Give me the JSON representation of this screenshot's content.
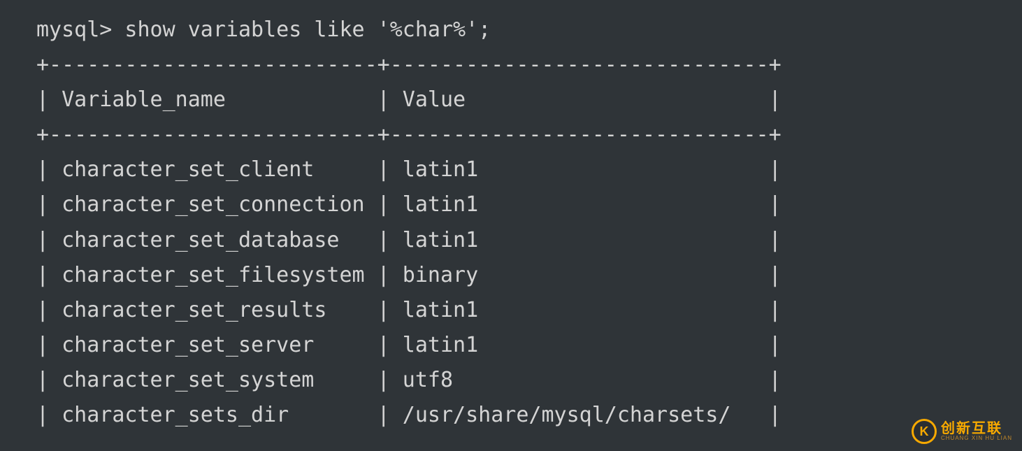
{
  "prompt": "mysql>",
  "command": "show variables like '%char%';",
  "headers": {
    "col1": "Variable_name",
    "col2": "Value"
  },
  "rows": [
    {
      "name": "character_set_client",
      "value": "latin1"
    },
    {
      "name": "character_set_connection",
      "value": "latin1"
    },
    {
      "name": "character_set_database",
      "value": "latin1"
    },
    {
      "name": "character_set_filesystem",
      "value": "binary"
    },
    {
      "name": "character_set_results",
      "value": "latin1"
    },
    {
      "name": "character_set_server",
      "value": "latin1"
    },
    {
      "name": "character_set_system",
      "value": "utf8"
    },
    {
      "name": "character_sets_dir",
      "value": "/usr/share/mysql/charsets/"
    }
  ],
  "col_widths": {
    "name": 24,
    "value": 28
  },
  "watermark": {
    "logo_letter": "K",
    "cn": "创新互联",
    "en": "CHUANG XIN HU LIAN"
  }
}
